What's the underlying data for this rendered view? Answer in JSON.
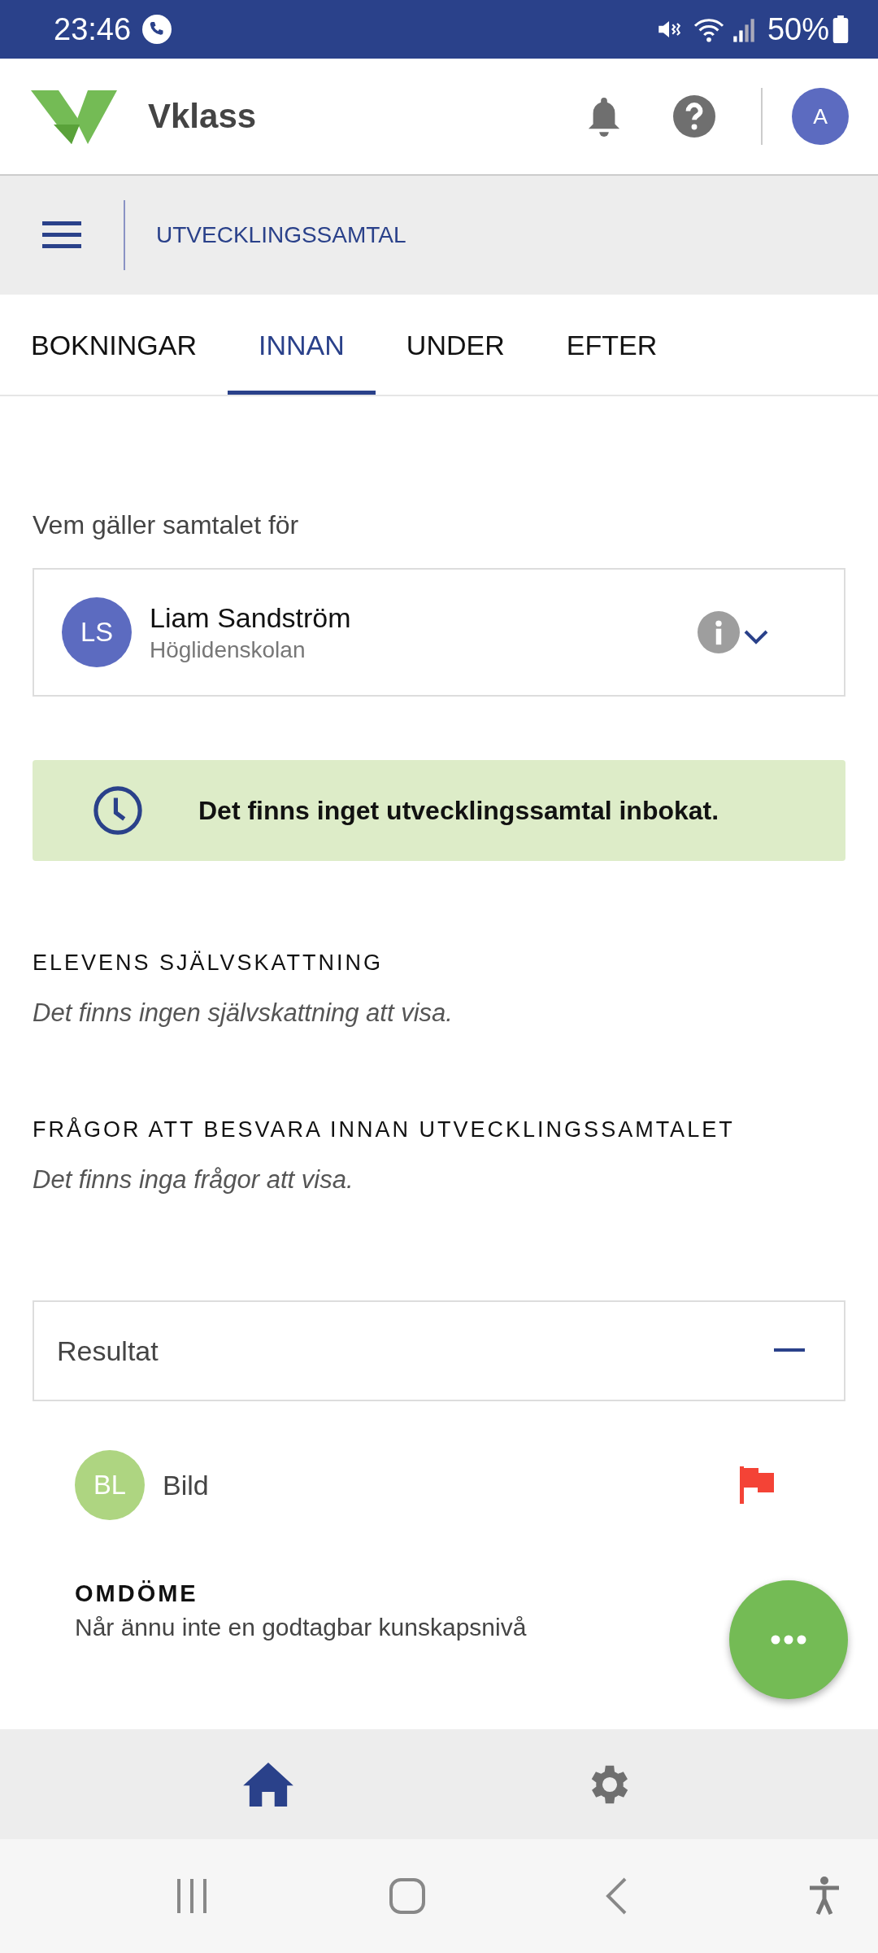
{
  "status_bar": {
    "time": "23:46",
    "battery": "50%"
  },
  "header": {
    "app_name": "Vklass",
    "avatar_initial": "A"
  },
  "subheader": {
    "title": "UTVECKLINGSSAMTAL"
  },
  "tabs": [
    {
      "label": "BOKNINGAR",
      "selected": false
    },
    {
      "label": "INNAN",
      "selected": true
    },
    {
      "label": "UNDER",
      "selected": false
    },
    {
      "label": "EFTER",
      "selected": false
    }
  ],
  "student_picker": {
    "label": "Vem gäller samtalet för",
    "initials": "LS",
    "name": "Liam Sandström",
    "school": "Höglidenskolan"
  },
  "notice": "Det finns inget utvecklingssamtal inbokat.",
  "sections": [
    {
      "title": "ELEVENS SJÄLVSKATTNING",
      "empty_text": "Det finns ingen självskattning att visa."
    },
    {
      "title": "FRÅGOR ATT BESVARA INNAN UTVECKLINGSSAMTALET",
      "empty_text": "Det finns inga frågor att visa."
    }
  ],
  "results": {
    "title": "Resultat",
    "expanded": true,
    "subjects": [
      {
        "initials": "BL",
        "name": "Bild",
        "color": "#aed581",
        "flagged": true,
        "assessment_title": "OMDÖME",
        "assessment": "Når ännu inte en godtagbar kunskapsnivå"
      }
    ]
  },
  "bottom_nav": [
    {
      "kind": "home",
      "selected": true
    },
    {
      "kind": "settings",
      "selected": false
    }
  ]
}
